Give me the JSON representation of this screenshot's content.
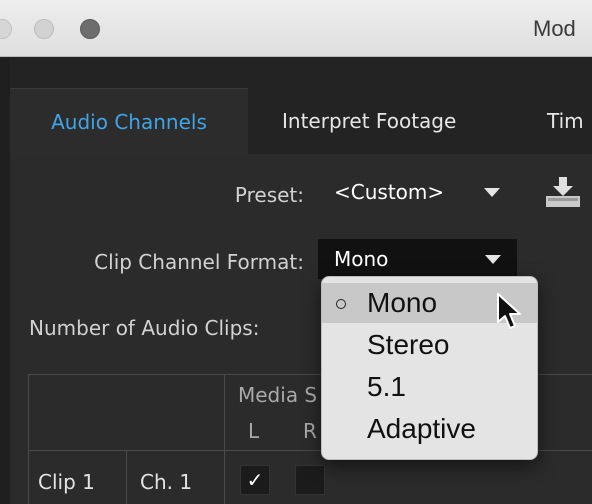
{
  "window": {
    "title": "Mod"
  },
  "tabs": [
    {
      "label": "Audio Channels",
      "active": true
    },
    {
      "label": "Interpret Footage",
      "active": false
    },
    {
      "label": "Tim",
      "active": false
    }
  ],
  "preset": {
    "label": "Preset:",
    "value": "<Custom>"
  },
  "clip_channel_format": {
    "label": "Clip Channel Format:",
    "value": "Mono"
  },
  "number_of_audio_clips": {
    "label": "Number of Audio Clips:"
  },
  "table": {
    "header_media": "Media S",
    "header_left": "L",
    "header_right": "R",
    "rows": [
      {
        "clip": "Clip 1",
        "channel": "Ch. 1",
        "left_checked": true,
        "left_mark": "✓",
        "right_checked": false
      }
    ]
  },
  "format_menu": {
    "options": [
      {
        "label": "Mono",
        "selected": true
      },
      {
        "label": "Stereo",
        "selected": false
      },
      {
        "label": "5.1",
        "selected": false
      },
      {
        "label": "Adaptive",
        "selected": false
      }
    ]
  },
  "colors": {
    "accent": "#41a4e4",
    "panel": "#2b2b2b",
    "menu": "#e4e4e4"
  },
  "icons": [
    "download-preset-icon",
    "mouse-pointer-icon",
    "radio-selected-icon",
    "chevron-down-icon"
  ]
}
